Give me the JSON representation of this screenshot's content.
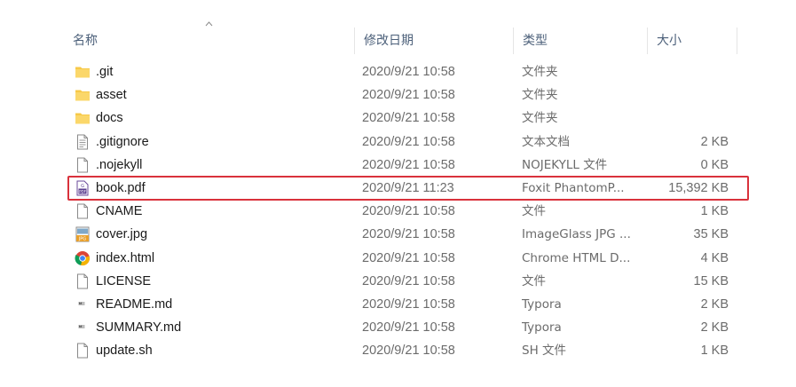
{
  "columns": {
    "name": "名称",
    "date": "修改日期",
    "type": "类型",
    "size": "大小"
  },
  "files": [
    {
      "name": ".git",
      "date": "2020/9/21 10:58",
      "type": "文件夹",
      "size": "",
      "icon": "folder-icon"
    },
    {
      "name": "asset",
      "date": "2020/9/21 10:58",
      "type": "文件夹",
      "size": "",
      "icon": "folder-icon"
    },
    {
      "name": "docs",
      "date": "2020/9/21 10:58",
      "type": "文件夹",
      "size": "",
      "icon": "folder-icon"
    },
    {
      "name": ".gitignore",
      "date": "2020/9/21 10:58",
      "type": "文本文档",
      "size": "2 KB",
      "icon": "text-file-icon"
    },
    {
      "name": ".nojekyll",
      "date": "2020/9/21 10:58",
      "type": "NOJEKYLL 文件",
      "size": "0 KB",
      "icon": "blank-file-icon"
    },
    {
      "name": "book.pdf",
      "date": "2020/9/21 11:23",
      "type": "Foxit PhantomP...",
      "size": "15,392 KB",
      "icon": "pdf-file-icon"
    },
    {
      "name": "CNAME",
      "date": "2020/9/21 10:58",
      "type": "文件",
      "size": "1 KB",
      "icon": "blank-file-icon"
    },
    {
      "name": "cover.jpg",
      "date": "2020/9/21 10:58",
      "type": "ImageGlass JPG ...",
      "size": "35 KB",
      "icon": "jpg-file-icon"
    },
    {
      "name": "index.html",
      "date": "2020/9/21 10:58",
      "type": "Chrome HTML D...",
      "size": "4 KB",
      "icon": "chrome-icon"
    },
    {
      "name": "LICENSE",
      "date": "2020/9/21 10:58",
      "type": "文件",
      "size": "15 KB",
      "icon": "blank-file-icon"
    },
    {
      "name": "README.md",
      "date": "2020/9/21 10:58",
      "type": "Typora",
      "size": "2 KB",
      "icon": "markdown-file-icon"
    },
    {
      "name": "SUMMARY.md",
      "date": "2020/9/21 10:58",
      "type": "Typora",
      "size": "2 KB",
      "icon": "markdown-file-icon"
    },
    {
      "name": "update.sh",
      "date": "2020/9/21 10:58",
      "type": "SH 文件",
      "size": "1 KB",
      "icon": "blank-file-icon"
    }
  ],
  "colors": {
    "folder": "#f7c948",
    "highlight": "#d9323c",
    "header_text": "#4c607a"
  }
}
